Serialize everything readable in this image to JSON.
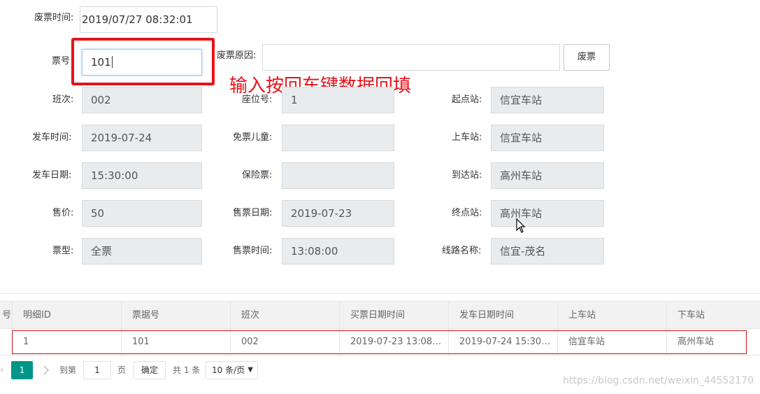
{
  "top": {
    "void_time_label": "废票时间:",
    "void_time_value": "2019/07/27 08:32:01",
    "ticket_no_label": "票号",
    "ticket_no_value": "101",
    "void_reason_label": "废票原因:",
    "void_reason_value": "",
    "void_button": "废票",
    "annotation": "输入按回车键数据回填"
  },
  "form": {
    "col1": [
      {
        "label": "班次:",
        "value": "002"
      },
      {
        "label": "发车时间:",
        "value": "2019-07-24"
      },
      {
        "label": "发车日期:",
        "value": "15:30:00"
      },
      {
        "label": "售价:",
        "value": "50"
      },
      {
        "label": "票型:",
        "value": "全票"
      }
    ],
    "col2": [
      {
        "label": "座位号:",
        "value": "1"
      },
      {
        "label": "免票儿童:",
        "value": ""
      },
      {
        "label": "保险票:",
        "value": ""
      },
      {
        "label": "售票日期:",
        "value": "2019-07-23"
      },
      {
        "label": "售票时间:",
        "value": "13:08:00"
      }
    ],
    "col3": [
      {
        "label": "起点站:",
        "value": "信宜车站"
      },
      {
        "label": "上车站:",
        "value": "信宜车站"
      },
      {
        "label": "到达站:",
        "value": "高州车站"
      },
      {
        "label": "终点站:",
        "value": "高州车站"
      },
      {
        "label": "线路名称:",
        "value": "信宜-茂名"
      }
    ]
  },
  "table": {
    "headers": [
      "号",
      "明细ID",
      "票据号",
      "班次",
      "买票日期时间",
      "发车日期时间",
      "上车站",
      "下车站"
    ],
    "rows": [
      [
        "",
        "1",
        "101",
        "002",
        "2019-07-23 13:08…",
        "2019-07-24 15:30…",
        "信宜车站",
        "高州车站"
      ]
    ]
  },
  "pager": {
    "current_page": "1",
    "goto_label": "到第",
    "goto_value": "1",
    "page_label": "页",
    "confirm_button": "确定",
    "total_text": "共 1 条",
    "page_size": "10 条/页"
  },
  "watermark": "https://blog.csdn.net/weixin_44552170",
  "colors": {
    "highlight_red": "#e8121b",
    "pager_accent": "#009688",
    "readonly_bg": "#e9ecef"
  },
  "icons": [
    "chevron-right-icon",
    "dropdown-arrow-icon",
    "mouse-cursor-icon"
  ]
}
